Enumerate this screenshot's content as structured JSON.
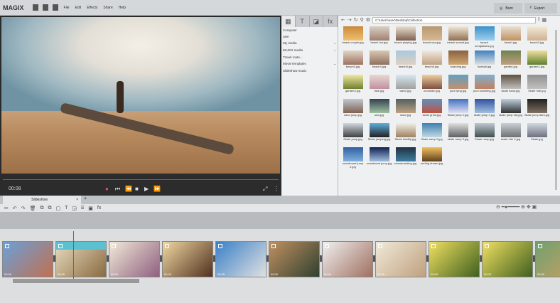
{
  "app": {
    "logo": "MAGIX",
    "menus": [
      "File",
      "Edit",
      "Effects",
      "Share",
      "Help"
    ],
    "burn": "Burn",
    "export": "Export"
  },
  "player": {
    "timecode": "00:08"
  },
  "panel": {
    "tabs": [
      "▦",
      "T",
      "◪",
      "fx"
    ],
    "items": [
      {
        "label": "Computer",
        "arrow": ""
      },
      {
        "label": "user",
        "arrow": ""
      },
      {
        "label": "My media",
        "arrow": "⌄"
      },
      {
        "label": "MAGIX media",
        "arrow": "⌄"
      },
      {
        "label": "Travel route...",
        "arrow": ""
      },
      {
        "label": "Movie templates",
        "arrow": "⌄"
      },
      {
        "label": "Slideshow music",
        "arrow": ""
      }
    ]
  },
  "browser": {
    "path": "C:\\Users\\user\\Desktop\\Collection",
    "files": [
      {
        "name": "beach couple.jpg",
        "c1": "#c98a3a",
        "c2": "#f0c070"
      },
      {
        "name": "beach fun.jpg",
        "c1": "#d8d0c4",
        "c2": "#a08070"
      },
      {
        "name": "beach playing.jpg",
        "c1": "#e8e0d0",
        "c2": "#806050"
      },
      {
        "name": "beach sea.jpg",
        "c1": "#b89870",
        "c2": "#d8b890"
      },
      {
        "name": "beach sunset.jpg",
        "c1": "#f0e8d8",
        "c2": "#907050"
      },
      {
        "name": "beach sunglasses.jpg",
        "c1": "#3a90c8",
        "c2": "#a0d0f0"
      },
      {
        "name": "beach.jpg",
        "c1": "#e8e0d0",
        "c2": "#c09060"
      },
      {
        "name": "beach3.jpg",
        "c1": "#f0ead8",
        "c2": "#d0b090"
      },
      {
        "name": "beach3.jpg",
        "c1": "#e0d8c8",
        "c2": "#a07060"
      },
      {
        "name": "beach4.jpg",
        "c1": "#d8c8b0",
        "c2": "#907060"
      },
      {
        "name": "beach5.jpg",
        "c1": "#a8c8e0",
        "c2": "#e0d0c0"
      },
      {
        "name": "beach6.jpg",
        "c1": "#f0e8e0",
        "c2": "#c0a080"
      },
      {
        "name": "boarding.jpg",
        "c1": "#8a6040",
        "c2": "#d0a870"
      },
      {
        "name": "football.jpg",
        "c1": "#4080c0",
        "c2": "#e0e0e0"
      },
      {
        "name": "garden.jpg",
        "c1": "#708050",
        "c2": "#c0a080"
      },
      {
        "name": "garden2.jpg",
        "c1": "#f0e0a0",
        "c2": "#608030"
      },
      {
        "name": "garden3.jpg",
        "c1": "#f0e8a0",
        "c2": "#708030"
      },
      {
        "name": "lake.jpg",
        "c1": "#e8d8d0",
        "c2": "#c090a0"
      },
      {
        "name": "lake2.jpg",
        "c1": "#d8e8f0",
        "c2": "#a0a0a0"
      },
      {
        "name": "mountain.jpg",
        "c1": "#f0d0a0",
        "c2": "#805040"
      },
      {
        "name": "pool lying.jpg",
        "c1": "#60a0c0",
        "c2": "#c09070"
      },
      {
        "name": "pool snorkling.jpg",
        "c1": "#80b0d0",
        "c2": "#c08060"
      },
      {
        "name": "skate hand.jpg",
        "c1": "#605040",
        "c2": "#c0c0c0"
      },
      {
        "name": "Skate ride.jpg",
        "c1": "#909090",
        "c2": "#c0c0c0"
      },
      {
        "name": "sand jump.jpg",
        "c1": "#c0c8d0",
        "c2": "#806050"
      },
      {
        "name": "sea.jpg",
        "c1": "#304050",
        "c2": "#a0c0a0"
      },
      {
        "name": "sea2.jpg",
        "c1": "#506060",
        "c2": "#c0a080"
      },
      {
        "name": "skate grind.jpg",
        "c1": "#6090c0",
        "c2": "#c05040"
      },
      {
        "name": "Skate jump 2.jpg",
        "c1": "#4070c0",
        "c2": "#e0e0f0"
      },
      {
        "name": "skate jump 3.jpg",
        "c1": "#3050a0",
        "c2": "#a0c0e0"
      },
      {
        "name": "skate jump city.jpg",
        "c1": "#c0d0e0",
        "c2": "#303030"
      },
      {
        "name": "Skate jump dark.jpg",
        "c1": "#202020",
        "c2": "#807060"
      },
      {
        "name": "Skate jump.jpg",
        "c1": "#d0d8e0",
        "c2": "#404040"
      },
      {
        "name": "Skate jumping.jpg",
        "c1": "#60b0e0",
        "c2": "#202020"
      },
      {
        "name": "Skate kickflip.jpg",
        "c1": "#f0f0e8",
        "c2": "#a08060"
      },
      {
        "name": "Skate ramp 2.jpg",
        "c1": "#4080b0",
        "c2": "#c0d8e0"
      },
      {
        "name": "skate ramp 3.jpg",
        "c1": "#e0e0e0",
        "c2": "#606060"
      },
      {
        "name": "Skate ramp.jpg",
        "c1": "#c0c8d0",
        "c2": "#405050"
      },
      {
        "name": "skate ride 2.jpg",
        "c1": "#c8d0d8",
        "c2": "#707070"
      },
      {
        "name": "Skate.jpg",
        "c1": "#d0d8e0",
        "c2": "#707080"
      },
      {
        "name": "snowboard jump 2.jpg",
        "c1": "#3060a0",
        "c2": "#80b0e0"
      },
      {
        "name": "snowboard jump.jpg",
        "c1": "#102050",
        "c2": "#a0c0e0"
      },
      {
        "name": "snowboarding.jpg",
        "c1": "#203040",
        "c2": "#4080a0"
      },
      {
        "name": "surfing dream.jpg",
        "c1": "#f0c060",
        "c2": "#604020"
      }
    ]
  },
  "timeline": {
    "tab": "Slideshow",
    "tools": [
      "✂",
      "↶",
      "↷",
      "🗑",
      "⧉",
      "⧉",
      "▢",
      "T",
      "◲",
      "⌸",
      "▣",
      "fx"
    ],
    "clips": [
      {
        "time": "00:05",
        "c1": "#6aa0d8",
        "c2": "#c07050"
      },
      {
        "time": "00:05",
        "c1": "#e8dcc0",
        "c2": "#8a6a40"
      },
      {
        "time": "00:05",
        "c1": "#f0ead8",
        "c2": "#906080"
      },
      {
        "time": "00:05",
        "c1": "#f0d8a0",
        "c2": "#503020"
      },
      {
        "time": "00:05",
        "c1": "#3a80c8",
        "c2": "#e0e0e0"
      },
      {
        "time": "00:05",
        "c1": "#c09060",
        "c2": "#304030"
      },
      {
        "time": "00:05",
        "c1": "#f0f0f0",
        "c2": "#a07060"
      },
      {
        "time": "00:05",
        "c1": "#f0ead8",
        "c2": "#c0a080"
      },
      {
        "time": "00:05",
        "c1": "#f0e060",
        "c2": "#406020"
      },
      {
        "time": "00:05",
        "c1": "#f0e060",
        "c2": "#406020"
      },
      {
        "time": "00:05",
        "c1": "#70a070",
        "c2": "#d0a060"
      }
    ]
  }
}
